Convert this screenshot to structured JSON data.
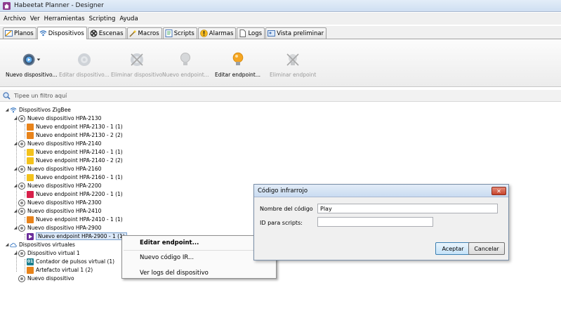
{
  "window": {
    "title": "Habeetat Planner - Designer"
  },
  "menu": [
    "Archivo",
    "Ver",
    "Herramientas",
    "Scripting",
    "Ayuda"
  ],
  "tabs": [
    "Planos",
    "Dispositivos",
    "Escenas",
    "Macros",
    "Scripts",
    "Alarmas",
    "Logs",
    "Vista preliminar"
  ],
  "active_tab": "Dispositivos",
  "toolbar": {
    "new_device": "Nuevo dispositivo...",
    "edit_device": "Editar dispositivo...",
    "delete_device": "Eliminar dispositivo",
    "new_endpoint": "Nuevo endpoint...",
    "edit_endpoint": "Editar endpoint...",
    "delete_endpoint": "Eliminar endpoint"
  },
  "filter": {
    "placeholder": "Tipee un filtro aquí"
  },
  "tree": {
    "zigbee": "Dispositivos ZigBee",
    "d2130": "Nuevo dispositivo HPA-2130",
    "e2130_1": "Nuevo endpoint HPA-2130 - 1 (1)",
    "e2130_2": "Nuevo endpoint HPA-2130 - 2 (2)",
    "d2140": "Nuevo dispositivo HPA-2140",
    "e2140_1": "Nuevo endpoint HPA-2140 - 1 (1)",
    "e2140_2": "Nuevo endpoint HPA-2140 - 2 (2)",
    "d2160": "Nuevo dispositivo HPA-2160",
    "e2160_1": "Nuevo endpoint HPA-2160 - 1 (1)",
    "d2200": "Nuevo dispositivo HPA-2200",
    "e2200_1": "Nuevo endpoint HPA-2200 - 1 (1)",
    "d2300": "Nuevo dispositivo HPA-2300",
    "d2410": "Nuevo dispositivo HPA-2410",
    "e2410_1": "Nuevo endpoint HPA-2410 - 1 (1)",
    "d2900": "Nuevo dispositivo HPA-2900",
    "e2900_1": "Nuevo endpoint HPA-2900 - 1 (1)",
    "virtual": "Dispositivos virtuales",
    "dv1": "Dispositivo virtual 1",
    "counter": "Contador de pulsos virtual (1)",
    "counter_icon_text": "01",
    "artefacto": "Artefacto virtual 1 (2)",
    "newdev": "Nuevo dispositivo"
  },
  "context_menu": {
    "edit_endpoint": "Editar endpoint...",
    "new_ir_code": "Nuevo código IR...",
    "view_logs": "Ver logs del dispositivo"
  },
  "dialog": {
    "title": "Código infrarrojo",
    "close": "✕",
    "code_name_label": "Nombre del código",
    "code_name_value": "Play",
    "script_id_label": "ID para scripts:",
    "script_id_value": "",
    "accept": "Aceptar",
    "cancel": "Cancelar"
  },
  "colors": {
    "orange": "#e8831a",
    "yellow": "#f3c21c",
    "pink": "#d8204a",
    "purple": "#6a2d9a",
    "teal": "#1b7f8e",
    "bulb": "#f5a623",
    "blue": "#2b6fbf"
  }
}
